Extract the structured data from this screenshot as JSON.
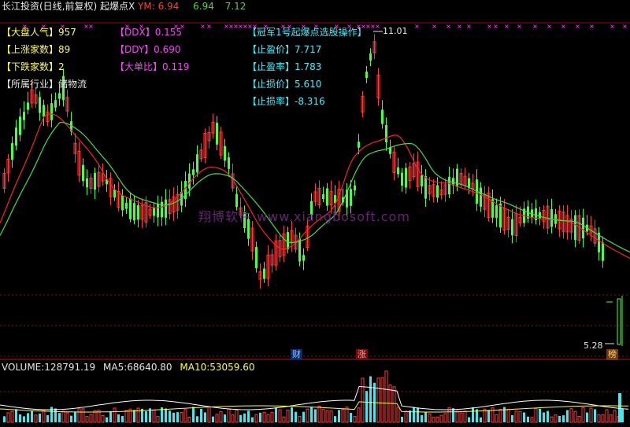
{
  "header": {
    "title": "长江投资(日线,前复权) 起爆点X",
    "ym_label": "YM:",
    "ym_value": "6.94",
    "value_green1": "6.94",
    "value_green2": "7.12"
  },
  "left_panel": [
    {
      "label": "【大盘人气】",
      "value": "957",
      "color": "#ffff3c"
    },
    {
      "label": "【上涨家数】",
      "value": "89",
      "color": "#ffff3c"
    },
    {
      "label": "【下跌家数】",
      "value": "2",
      "color": "#ffff3c"
    },
    {
      "label": "【所属行业】",
      "value": "储物流",
      "color": "#e6e6e6"
    }
  ],
  "mid_panel": [
    {
      "label": "【DDX】",
      "value": "0.155"
    },
    {
      "label": "【DDY】",
      "value": "0.690"
    },
    {
      "label": "【大单比】",
      "value": "0.119"
    }
  ],
  "right_panel": [
    {
      "label": "【冠军1号起爆点选股操作】",
      "value": ""
    },
    {
      "label": "【止盈价】",
      "value": "7.717"
    },
    {
      "label": "【止盈率】",
      "value": "1.783"
    },
    {
      "label": "【止损价】",
      "value": "5.610"
    },
    {
      "label": "【止损率】",
      "value": "-8.316"
    }
  ],
  "price_markers": {
    "high": "11.01",
    "low": "5.28"
  },
  "badges": {
    "cai": "财",
    "zhang": "涨",
    "bang": "榜"
  },
  "volume": {
    "label": "VOLUME:",
    "value": "128791.19",
    "ma5_label": "MA5:",
    "ma5_value": "68640.80",
    "ma10_label": "MA10:",
    "ma10_value": "53059.60"
  },
  "watermark": "翔博软件 www.xiangbosoft.com",
  "colors": {
    "up": "#ff3c3c",
    "down": "#48ff48",
    "ma_red": "#ff2020",
    "ma_green": "#40e040",
    "vol_cyan": "#40e8f0",
    "marker_magenta": "#ff40ff"
  }
}
